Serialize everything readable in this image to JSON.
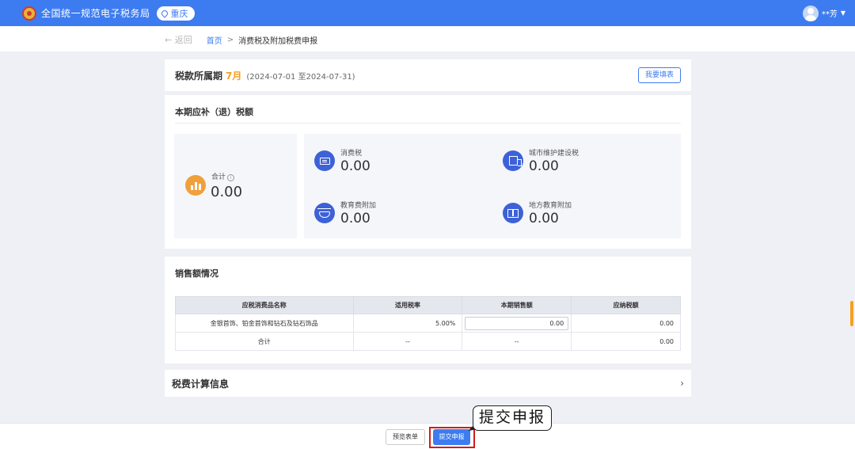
{
  "header": {
    "app_title": "全国统一规范电子税务局",
    "region": "重庆",
    "user_name": "**芳"
  },
  "breadcrumb": {
    "back": "← 返回",
    "home": "首页",
    "separator": ">",
    "current": "消费税及附加税费申报"
  },
  "period": {
    "label": "税款所属期",
    "month": "7月",
    "range": "(2024-07-01 至2024-07-31)",
    "fill_button": "我要填表"
  },
  "tax": {
    "section_title": "本期应补（退）税额",
    "total": {
      "label": "合计",
      "value": "0.00"
    },
    "items": [
      {
        "label": "消费税",
        "value": "0.00",
        "icon": "tax-card-icon"
      },
      {
        "label": "城市维护建设税",
        "value": "0.00",
        "icon": "building-icon"
      },
      {
        "label": "教育费附加",
        "value": "0.00",
        "icon": "graduation-cap-icon"
      },
      {
        "label": "地方教育附加",
        "value": "0.00",
        "icon": "book-icon"
      }
    ]
  },
  "sales": {
    "section_title": "销售额情况",
    "columns": [
      "应税消费品名称",
      "适用税率",
      "本期销售额",
      "应纳税额"
    ],
    "rows": [
      {
        "name": "金银首饰、铂金首饰和钻石及钻石饰品",
        "rate": "5.00%",
        "sales": "0.00",
        "tax": "0.00"
      },
      {
        "name": "合计",
        "rate": "--",
        "sales": "--",
        "tax": "0.00"
      }
    ]
  },
  "calc": {
    "title": "税费计算信息"
  },
  "footer": {
    "preview": "预览表单",
    "submit": "提交申报"
  },
  "annotation": {
    "callout": "提交申报"
  },
  "colors": {
    "primary": "#3d7cf0",
    "accent": "#f5a020",
    "highlight": "#d31b1b"
  }
}
